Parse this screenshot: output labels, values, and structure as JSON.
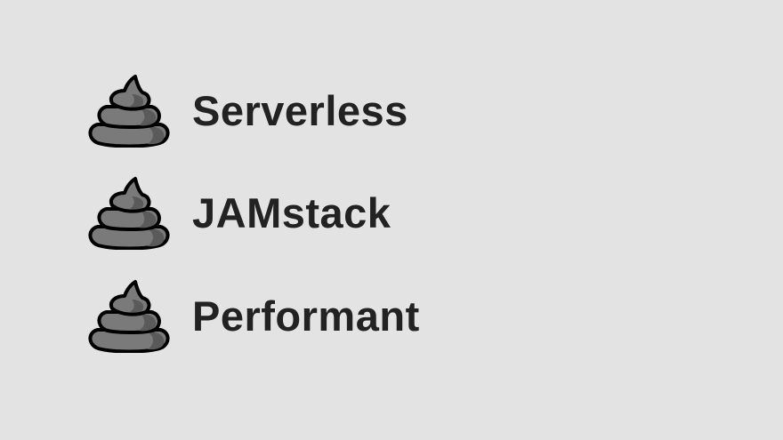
{
  "items": [
    {
      "label": "Serverless",
      "icon": "pile-of-poo-icon"
    },
    {
      "label": "JAMstack",
      "icon": "pile-of-poo-icon"
    },
    {
      "label": "Performant",
      "icon": "pile-of-poo-icon"
    }
  ],
  "colors": {
    "background": "#e3e3e3",
    "text": "#222222",
    "icon_fill": "#7a7a7a",
    "icon_shadow": "#5a5a5a",
    "icon_outline": "#000000"
  }
}
